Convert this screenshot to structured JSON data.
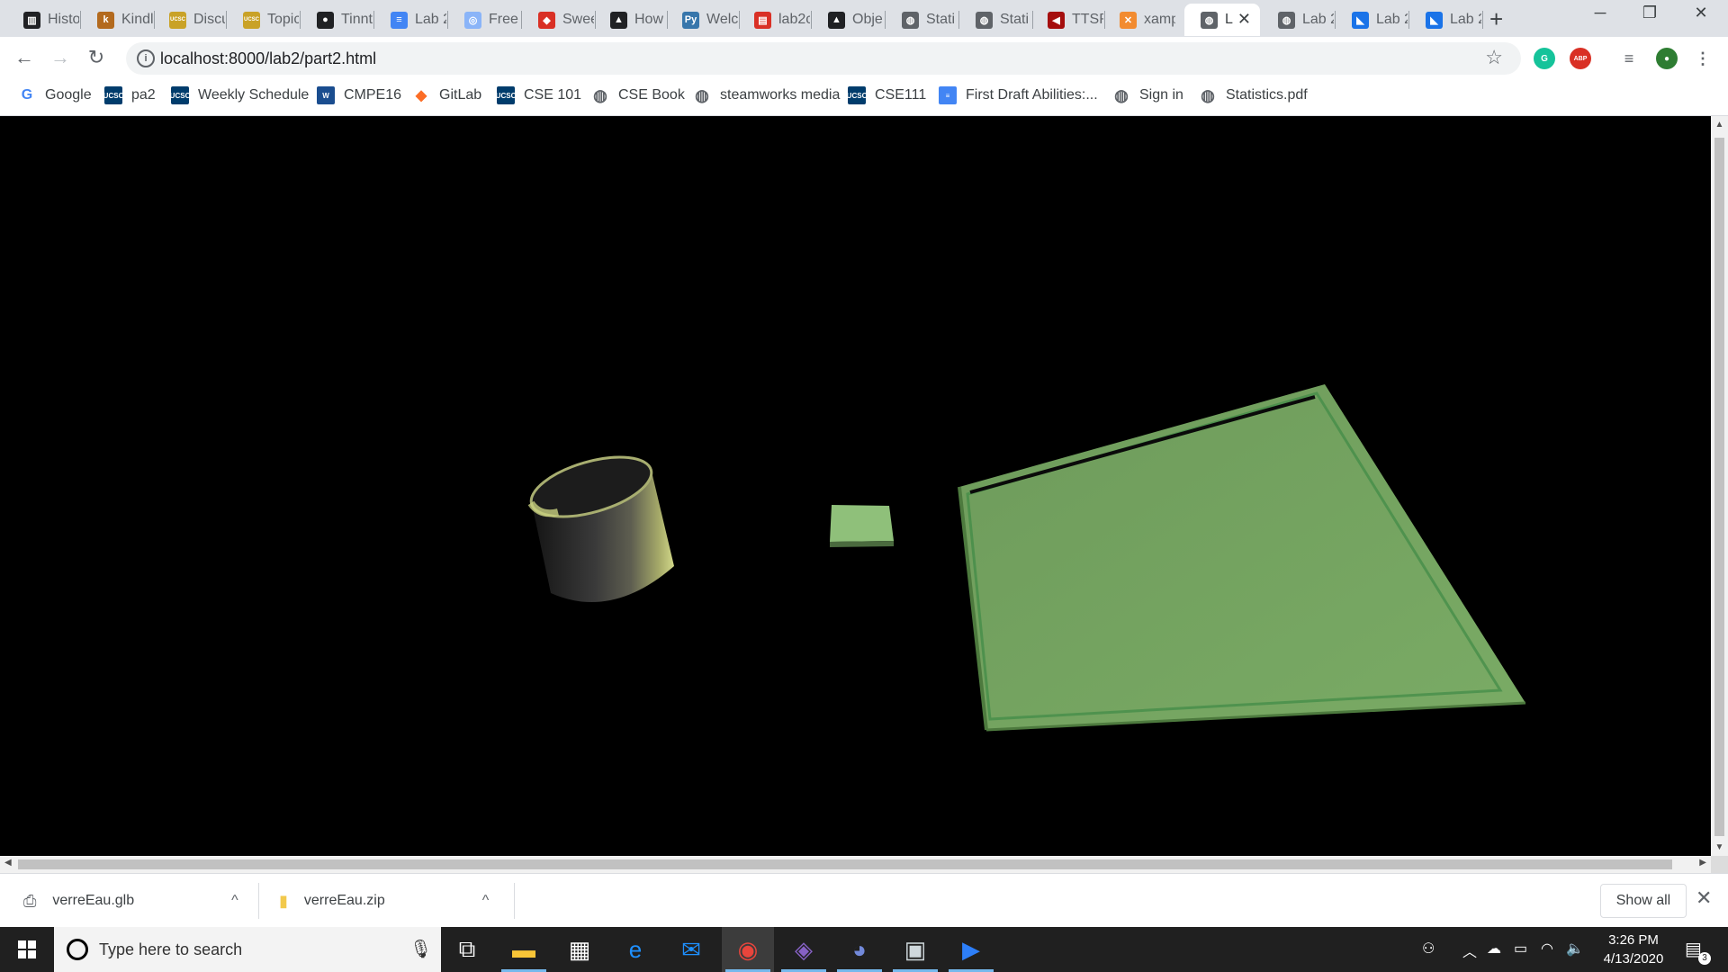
{
  "tabs": [
    {
      "title": "Histo",
      "icon": "history-icon",
      "color": "#202124",
      "glyph": "▥"
    },
    {
      "title": "Kindl",
      "icon": "kindle-icon",
      "color": "#b36a1e",
      "glyph": "k"
    },
    {
      "title": "Discu",
      "icon": "ucsc-icon",
      "color": "#c9a227",
      "glyph": "UCSC"
    },
    {
      "title": "Topic",
      "icon": "ucsc-icon",
      "color": "#c9a227",
      "glyph": "UCSC"
    },
    {
      "title": "Tinnt",
      "icon": "github-icon",
      "color": "#202124",
      "glyph": "●"
    },
    {
      "title": "Lab 2",
      "icon": "docs-icon",
      "color": "#4285f4",
      "glyph": "≡"
    },
    {
      "title": "Free",
      "icon": "chrome-ext-icon",
      "color": "#8ab4f8",
      "glyph": "◎"
    },
    {
      "title": "Swee",
      "icon": "swe-icon",
      "color": "#d93025",
      "glyph": "◆"
    },
    {
      "title": "How",
      "icon": "threejs-icon",
      "color": "#202124",
      "glyph": "▲"
    },
    {
      "title": "Welc",
      "icon": "python-icon",
      "color": "#3776ab",
      "glyph": "Py"
    },
    {
      "title": "lab2c",
      "icon": "slides-icon",
      "color": "#d93025",
      "glyph": "▤"
    },
    {
      "title": "Obje",
      "icon": "threejs-icon",
      "color": "#202124",
      "glyph": "▲"
    },
    {
      "title": "Stati",
      "icon": "globe-icon",
      "color": "#5f6368",
      "glyph": "◍"
    },
    {
      "title": "Stati",
      "icon": "globe-icon",
      "color": "#5f6368",
      "glyph": "◍"
    },
    {
      "title": "TTSR",
      "icon": "ttsr-icon",
      "color": "#a50e0e",
      "glyph": "◀"
    },
    {
      "title": "xamp",
      "icon": "xampp-icon",
      "color": "#f28b30",
      "glyph": "✕"
    },
    {
      "title": "L",
      "icon": "globe-icon",
      "color": "#5f6368",
      "glyph": "◍",
      "active": true
    },
    {
      "title": "Lab 2",
      "icon": "globe-icon",
      "color": "#5f6368",
      "glyph": "◍"
    },
    {
      "title": "Lab 2",
      "icon": "canvas-icon",
      "color": "#1a73e8",
      "glyph": "◣"
    },
    {
      "title": "Lab 2",
      "icon": "canvas-icon",
      "color": "#1a73e8",
      "glyph": "◣"
    }
  ],
  "window_controls": {
    "minimize": "─",
    "restore": "❐",
    "close": "✕"
  },
  "toolbar": {
    "back": "←",
    "forward": "→",
    "reload": "↻",
    "url": "localhost:8000/lab2/part2.html",
    "info": "i",
    "star": "☆",
    "extensions": [
      {
        "name": "grammarly-icon",
        "color": "#15c39a",
        "glyph": "G"
      },
      {
        "name": "adblock-icon",
        "color": "#d93025",
        "glyph": "ABP"
      },
      {
        "name": "media-icon",
        "color": "#ffffff",
        "glyph": "≡"
      },
      {
        "name": "profile-avatar",
        "color": "#2e7d32",
        "glyph": "●"
      },
      {
        "name": "menu-icon",
        "color": "#ffffff",
        "glyph": "⋮"
      }
    ]
  },
  "bookmarks": [
    {
      "label": "Google",
      "icon": "google-icon",
      "color": "#4285f4",
      "glyph": "G"
    },
    {
      "label": "pa2",
      "icon": "ucsc-icon",
      "color": "#003c6c",
      "glyph": "UCSC"
    },
    {
      "label": "Weekly Schedule",
      "icon": "ucsc-icon",
      "color": "#003c6c",
      "glyph": "UCSC"
    },
    {
      "label": "CMPE16",
      "icon": "ucsc-icon",
      "color": "#1a4d8f",
      "glyph": "W"
    },
    {
      "label": "GitLab",
      "icon": "gitlab-icon",
      "color": "#fc6d26",
      "glyph": "◆"
    },
    {
      "label": "CSE 101",
      "icon": "ucsc-icon",
      "color": "#003c6c",
      "glyph": "UCSC"
    },
    {
      "label": "CSE Book",
      "icon": "globe-icon",
      "color": "#5f6368",
      "glyph": "◍"
    },
    {
      "label": "steamworks media",
      "icon": "globe-icon",
      "color": "#5f6368",
      "glyph": "◍"
    },
    {
      "label": "CSE111",
      "icon": "ucsc-icon",
      "color": "#003c6c",
      "glyph": "UCSC"
    },
    {
      "label": "First Draft Abilities:...",
      "icon": "docs-icon",
      "color": "#4285f4",
      "glyph": "≡"
    },
    {
      "label": "Sign in",
      "icon": "globe-icon",
      "color": "#5f6368",
      "glyph": "◍"
    },
    {
      "label": "Statistics.pdf",
      "icon": "globe-icon",
      "color": "#5f6368",
      "glyph": "◍"
    }
  ],
  "scene": {
    "background": "#000000",
    "objects": [
      "glass-cylinder",
      "small-green-cube",
      "green-tray"
    ],
    "colors": {
      "cylinder_rim": "#c8d080",
      "cube": "#8fc07a",
      "tray": "#74a45f",
      "tray_edge": "#3f8a46"
    }
  },
  "downloads": [
    {
      "name": "verreEau.glb",
      "icon": "file-icon"
    },
    {
      "name": "verreEau.zip",
      "icon": "zip-icon"
    }
  ],
  "shelf": {
    "show_all": "Show all",
    "close": "✕",
    "caret": "^"
  },
  "taskbar": {
    "search_placeholder": "Type here to search",
    "apps": [
      {
        "name": "task-view-icon",
        "glyph": "⧉",
        "color": "#ffffff"
      },
      {
        "name": "file-explorer-icon",
        "glyph": "▬",
        "color": "#f8c537"
      },
      {
        "name": "store-icon",
        "glyph": "▦",
        "color": "#ffffff"
      },
      {
        "name": "edge-icon",
        "glyph": "e",
        "color": "#1e90ff"
      },
      {
        "name": "mail-icon",
        "glyph": "✉",
        "color": "#1e90ff"
      },
      {
        "name": "chrome-icon",
        "glyph": "◉",
        "color": "#e8453c",
        "active": true
      },
      {
        "name": "visual-studio-icon",
        "glyph": "◈",
        "color": "#8661c5"
      },
      {
        "name": "discord-icon",
        "glyph": "◕",
        "color": "#7289da"
      },
      {
        "name": "network-app-icon",
        "glyph": "▣",
        "color": "#cfd8dc"
      },
      {
        "name": "powershell-icon",
        "glyph": "▶",
        "color": "#2d7ff9"
      }
    ],
    "time": "3:26 PM",
    "date": "4/13/2020",
    "notifications": "3"
  }
}
